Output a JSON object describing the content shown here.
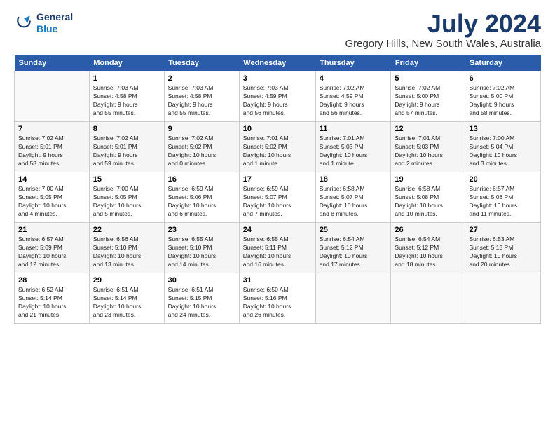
{
  "logo": {
    "line1": "General",
    "line2": "Blue"
  },
  "title": "July 2024",
  "location": "Gregory Hills, New South Wales, Australia",
  "days_header": [
    "Sunday",
    "Monday",
    "Tuesday",
    "Wednesday",
    "Thursday",
    "Friday",
    "Saturday"
  ],
  "weeks": [
    [
      {
        "num": "",
        "info": ""
      },
      {
        "num": "1",
        "info": "Sunrise: 7:03 AM\nSunset: 4:58 PM\nDaylight: 9 hours\nand 55 minutes."
      },
      {
        "num": "2",
        "info": "Sunrise: 7:03 AM\nSunset: 4:58 PM\nDaylight: 9 hours\nand 55 minutes."
      },
      {
        "num": "3",
        "info": "Sunrise: 7:03 AM\nSunset: 4:59 PM\nDaylight: 9 hours\nand 56 minutes."
      },
      {
        "num": "4",
        "info": "Sunrise: 7:02 AM\nSunset: 4:59 PM\nDaylight: 9 hours\nand 56 minutes."
      },
      {
        "num": "5",
        "info": "Sunrise: 7:02 AM\nSunset: 5:00 PM\nDaylight: 9 hours\nand 57 minutes."
      },
      {
        "num": "6",
        "info": "Sunrise: 7:02 AM\nSunset: 5:00 PM\nDaylight: 9 hours\nand 58 minutes."
      }
    ],
    [
      {
        "num": "7",
        "info": "Sunrise: 7:02 AM\nSunset: 5:01 PM\nDaylight: 9 hours\nand 58 minutes."
      },
      {
        "num": "8",
        "info": "Sunrise: 7:02 AM\nSunset: 5:01 PM\nDaylight: 9 hours\nand 59 minutes."
      },
      {
        "num": "9",
        "info": "Sunrise: 7:02 AM\nSunset: 5:02 PM\nDaylight: 10 hours\nand 0 minutes."
      },
      {
        "num": "10",
        "info": "Sunrise: 7:01 AM\nSunset: 5:02 PM\nDaylight: 10 hours\nand 1 minute."
      },
      {
        "num": "11",
        "info": "Sunrise: 7:01 AM\nSunset: 5:03 PM\nDaylight: 10 hours\nand 1 minute."
      },
      {
        "num": "12",
        "info": "Sunrise: 7:01 AM\nSunset: 5:03 PM\nDaylight: 10 hours\nand 2 minutes."
      },
      {
        "num": "13",
        "info": "Sunrise: 7:00 AM\nSunset: 5:04 PM\nDaylight: 10 hours\nand 3 minutes."
      }
    ],
    [
      {
        "num": "14",
        "info": "Sunrise: 7:00 AM\nSunset: 5:05 PM\nDaylight: 10 hours\nand 4 minutes."
      },
      {
        "num": "15",
        "info": "Sunrise: 7:00 AM\nSunset: 5:05 PM\nDaylight: 10 hours\nand 5 minutes."
      },
      {
        "num": "16",
        "info": "Sunrise: 6:59 AM\nSunset: 5:06 PM\nDaylight: 10 hours\nand 6 minutes."
      },
      {
        "num": "17",
        "info": "Sunrise: 6:59 AM\nSunset: 5:07 PM\nDaylight: 10 hours\nand 7 minutes."
      },
      {
        "num": "18",
        "info": "Sunrise: 6:58 AM\nSunset: 5:07 PM\nDaylight: 10 hours\nand 8 minutes."
      },
      {
        "num": "19",
        "info": "Sunrise: 6:58 AM\nSunset: 5:08 PM\nDaylight: 10 hours\nand 10 minutes."
      },
      {
        "num": "20",
        "info": "Sunrise: 6:57 AM\nSunset: 5:08 PM\nDaylight: 10 hours\nand 11 minutes."
      }
    ],
    [
      {
        "num": "21",
        "info": "Sunrise: 6:57 AM\nSunset: 5:09 PM\nDaylight: 10 hours\nand 12 minutes."
      },
      {
        "num": "22",
        "info": "Sunrise: 6:56 AM\nSunset: 5:10 PM\nDaylight: 10 hours\nand 13 minutes."
      },
      {
        "num": "23",
        "info": "Sunrise: 6:55 AM\nSunset: 5:10 PM\nDaylight: 10 hours\nand 14 minutes."
      },
      {
        "num": "24",
        "info": "Sunrise: 6:55 AM\nSunset: 5:11 PM\nDaylight: 10 hours\nand 16 minutes."
      },
      {
        "num": "25",
        "info": "Sunrise: 6:54 AM\nSunset: 5:12 PM\nDaylight: 10 hours\nand 17 minutes."
      },
      {
        "num": "26",
        "info": "Sunrise: 6:54 AM\nSunset: 5:12 PM\nDaylight: 10 hours\nand 18 minutes."
      },
      {
        "num": "27",
        "info": "Sunrise: 6:53 AM\nSunset: 5:13 PM\nDaylight: 10 hours\nand 20 minutes."
      }
    ],
    [
      {
        "num": "28",
        "info": "Sunrise: 6:52 AM\nSunset: 5:14 PM\nDaylight: 10 hours\nand 21 minutes."
      },
      {
        "num": "29",
        "info": "Sunrise: 6:51 AM\nSunset: 5:14 PM\nDaylight: 10 hours\nand 23 minutes."
      },
      {
        "num": "30",
        "info": "Sunrise: 6:51 AM\nSunset: 5:15 PM\nDaylight: 10 hours\nand 24 minutes."
      },
      {
        "num": "31",
        "info": "Sunrise: 6:50 AM\nSunset: 5:16 PM\nDaylight: 10 hours\nand 26 minutes."
      },
      {
        "num": "",
        "info": ""
      },
      {
        "num": "",
        "info": ""
      },
      {
        "num": "",
        "info": ""
      }
    ]
  ]
}
